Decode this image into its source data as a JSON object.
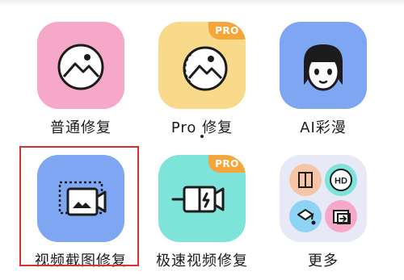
{
  "tiles": [
    {
      "label": "普通修复",
      "icon": "image-landscape-icon",
      "color": "#f6a8c8"
    },
    {
      "label": "Pro 修复",
      "icon": "image-landscape-pro-icon",
      "color": "#f9d98a",
      "badge": "PRO"
    },
    {
      "label": "AI彩漫",
      "icon": "anime-face-icon",
      "color": "#7fa6f3"
    },
    {
      "label": "视频截图修复",
      "icon": "video-screenshot-icon",
      "color": "#7fa6f3"
    },
    {
      "label": "极速视频修复",
      "icon": "fast-video-icon",
      "color": "#7ee3d8",
      "badge": "PRO"
    },
    {
      "label": "更多",
      "icon": "more-grid-icon",
      "color": "#e8e9f7"
    }
  ],
  "more_items": [
    {
      "icon": "compare-split-icon",
      "color": "#f8c4a6"
    },
    {
      "icon": "hd-icon",
      "text": "HD",
      "color": "#7ee3d8"
    },
    {
      "icon": "color-fill-icon",
      "color": "#8fd3f4"
    },
    {
      "icon": "resize-icon",
      "color": "#f6a8c8"
    }
  ],
  "colors": {
    "highlight": "#d9322e",
    "badge": "#f5a53a"
  }
}
